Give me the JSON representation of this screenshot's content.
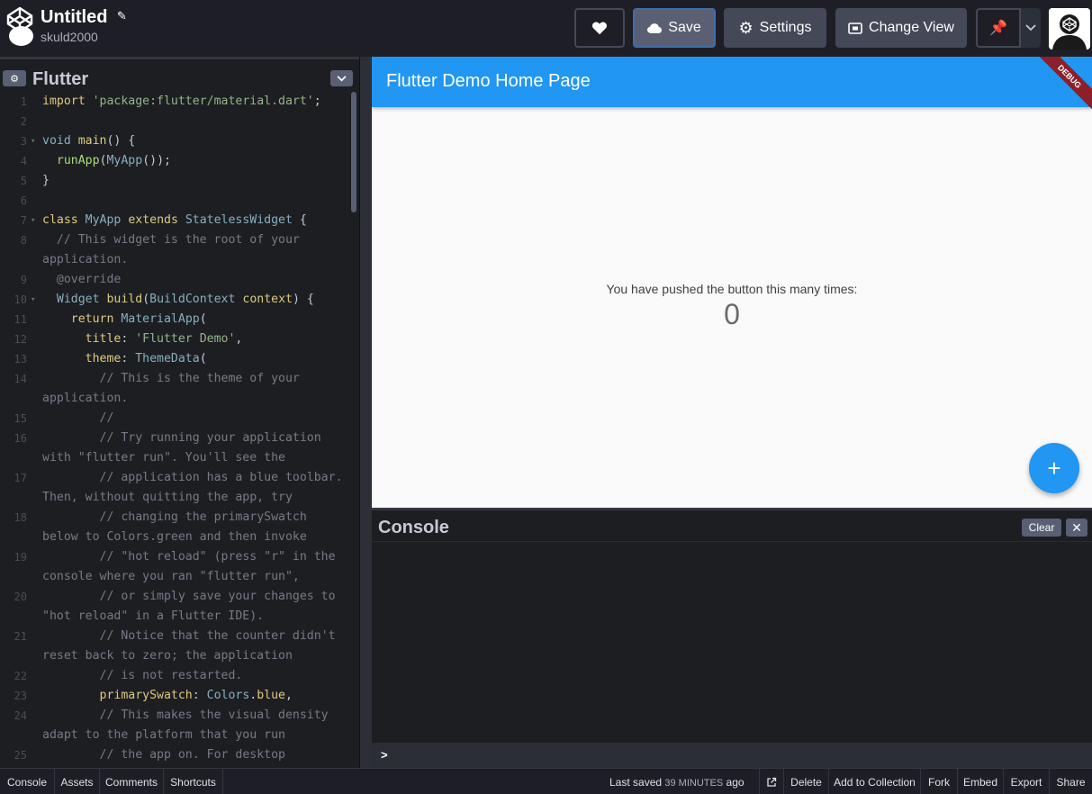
{
  "header": {
    "title": "Untitled",
    "username": "skuld2000",
    "buttons": {
      "save": "Save",
      "settings": "Settings",
      "change_view": "Change View"
    }
  },
  "editor": {
    "title": "Flutter",
    "lines": [
      {
        "n": "1",
        "fold": "",
        "html": "<span class='c-kw'>import</span> <span class='c-str'>'package:flutter/material.dart'</span>;"
      },
      {
        "n": "2",
        "fold": "",
        "html": ""
      },
      {
        "n": "3",
        "fold": "▾",
        "html": "<span class='c-type'>void</span> <span class='c-kw'>main</span>() {"
      },
      {
        "n": "4",
        "fold": "",
        "html": "  <span class='c-fn'>runApp</span>(<span class='c-type'>MyApp</span>());"
      },
      {
        "n": "5",
        "fold": "",
        "html": "}"
      },
      {
        "n": "6",
        "fold": "",
        "html": ""
      },
      {
        "n": "7",
        "fold": "▾",
        "html": "<span class='c-kw'>class</span> <span class='c-type'>MyApp</span> <span class='c-kw'>extends</span> <span class='c-type'>StatelessWidget</span> {"
      },
      {
        "n": "8",
        "fold": "",
        "html": "  <span class='c-cm'>// This widget is the root of your</span>"
      },
      {
        "n": "",
        "fold": "",
        "html": "<span class='c-cm'>application.</span>"
      },
      {
        "n": "9",
        "fold": "",
        "html": "  <span class='c-cm'>@override</span>"
      },
      {
        "n": "10",
        "fold": "▾",
        "html": "  <span class='c-type'>Widget</span> <span class='c-kw'>build</span>(<span class='c-type'>BuildContext</span> <span class='c-kw'>context</span>) {"
      },
      {
        "n": "11",
        "fold": "",
        "html": "    <span class='c-kw'>return</span> <span class='c-type'>MaterialApp</span>("
      },
      {
        "n": "12",
        "fold": "",
        "html": "      <span class='c-kw'>title</span>: <span class='c-str'>'Flutter Demo'</span>,"
      },
      {
        "n": "13",
        "fold": "",
        "html": "      <span class='c-kw'>theme</span>: <span class='c-type'>ThemeData</span>("
      },
      {
        "n": "14",
        "fold": "",
        "html": "        <span class='c-cm'>// This is the theme of your</span>"
      },
      {
        "n": "",
        "fold": "",
        "html": "<span class='c-cm'>application.</span>"
      },
      {
        "n": "15",
        "fold": "",
        "html": "        <span class='c-cm'>//</span>"
      },
      {
        "n": "16",
        "fold": "",
        "html": "        <span class='c-cm'>// Try running your application</span>"
      },
      {
        "n": "",
        "fold": "",
        "html": "<span class='c-cm'>with \"flutter run\". You'll see the</span>"
      },
      {
        "n": "17",
        "fold": "",
        "html": "        <span class='c-cm'>// application has a blue toolbar.</span>"
      },
      {
        "n": "",
        "fold": "",
        "html": "<span class='c-cm'>Then, without quitting the app, try</span>"
      },
      {
        "n": "18",
        "fold": "",
        "html": "        <span class='c-cm'>// changing the primarySwatch</span>"
      },
      {
        "n": "",
        "fold": "",
        "html": "<span class='c-cm'>below to Colors.green and then invoke</span>"
      },
      {
        "n": "19",
        "fold": "",
        "html": "        <span class='c-cm'>// \"hot reload\" (press \"r\" in the</span>"
      },
      {
        "n": "",
        "fold": "",
        "html": "<span class='c-cm'>console where you ran \"flutter run\",</span>"
      },
      {
        "n": "20",
        "fold": "",
        "html": "        <span class='c-cm'>// or simply save your changes to</span>"
      },
      {
        "n": "",
        "fold": "",
        "html": "<span class='c-cm'>\"hot reload\" in a Flutter IDE).</span>"
      },
      {
        "n": "21",
        "fold": "",
        "html": "        <span class='c-cm'>// Notice that the counter didn't</span>"
      },
      {
        "n": "",
        "fold": "",
        "html": "<span class='c-cm'>reset back to zero; the application</span>"
      },
      {
        "n": "22",
        "fold": "",
        "html": "        <span class='c-cm'>// is not restarted.</span>"
      },
      {
        "n": "23",
        "fold": "",
        "html": "        <span class='c-kw'>primarySwatch</span>: <span class='c-type'>Colors</span>.<span class='c-kw'>blue</span>,"
      },
      {
        "n": "24",
        "fold": "",
        "html": "        <span class='c-cm'>// This makes the visual density</span>"
      },
      {
        "n": "",
        "fold": "",
        "html": "<span class='c-cm'>adapt to the platform that you run</span>"
      },
      {
        "n": "25",
        "fold": "",
        "html": "        <span class='c-cm'>// the app on. For desktop</span>"
      }
    ]
  },
  "preview": {
    "appbar_title": "Flutter Demo Home Page",
    "debug": "DEBUG",
    "pushed_text": "You have pushed the button this many times:",
    "counter": "0",
    "fab": "+"
  },
  "console": {
    "title": "Console",
    "clear": "Clear",
    "prompt": ">"
  },
  "footer": {
    "tabs": [
      "Console",
      "Assets",
      "Comments",
      "Shortcuts"
    ],
    "last_saved_prefix": "Last saved",
    "last_saved_time": "39 MINUTES",
    "last_saved_suffix": "ago",
    "actions": [
      "Delete",
      "Add to Collection",
      "Fork",
      "Embed",
      "Export",
      "Share"
    ]
  },
  "colors": {
    "accent_blue": "#2196f3",
    "bg_dark": "#1e1f26",
    "button_gray": "#444857"
  }
}
